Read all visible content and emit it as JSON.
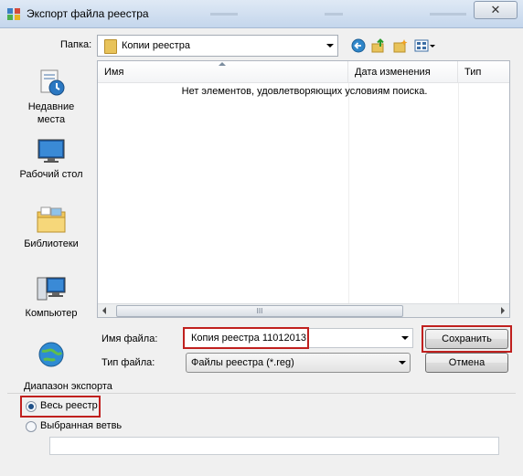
{
  "window": {
    "title": "Экспорт файла реестра",
    "close_glyph": "✕",
    "title_icon": "registry-export-icon"
  },
  "toolbar": {
    "folder_label": "Папка:",
    "folder_value": "Копии реестра",
    "back_icon": "back-arrow-icon",
    "up_icon": "folder-up-icon",
    "new_folder_icon": "new-folder-icon",
    "views_icon": "views-menu-icon"
  },
  "sidebar": {
    "items": [
      {
        "label": "Недавние\nместа",
        "icon": "recent-places-icon"
      },
      {
        "label": "Рабочий стол",
        "icon": "desktop-icon"
      },
      {
        "label": "Библиотеки",
        "icon": "libraries-icon"
      },
      {
        "label": "Компьютер",
        "icon": "computer-icon"
      },
      {
        "label": "",
        "icon": "network-icon"
      }
    ]
  },
  "filelist": {
    "columns": [
      "Имя",
      "Дата изменения",
      "Тип"
    ],
    "empty_message": "Нет элементов, удовлетворяющих условиям поиска.",
    "scroll_grip": "III"
  },
  "form": {
    "filename_label": "Имя файла:",
    "filename_value": "Копия реестра 11012013",
    "filetype_label": "Тип файла:",
    "filetype_value": "Файлы реестра (*.reg)",
    "save_label": "Сохранить",
    "cancel_label": "Отмена"
  },
  "export_range": {
    "title": "Диапазон экспорта",
    "options": [
      {
        "label": "Весь реестр",
        "selected": true
      },
      {
        "label": "Выбранная ветвь",
        "selected": false
      }
    ],
    "branch_value": ""
  },
  "colors": {
    "highlight": "#c0201e",
    "window_bg": "#f0f0f0"
  }
}
